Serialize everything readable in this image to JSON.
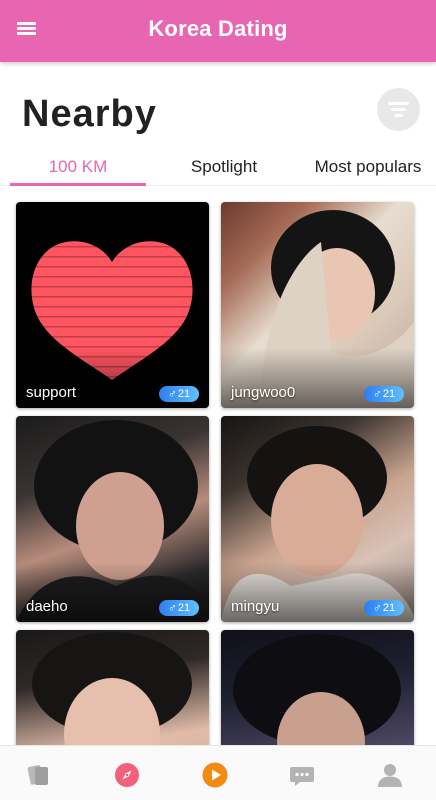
{
  "app_title": "Korea Dating",
  "page_title": "Nearby",
  "tabs": [
    {
      "label": "100 KM",
      "active": true
    },
    {
      "label": "Spotlight",
      "active": false
    },
    {
      "label": "Most populars",
      "active": false
    }
  ],
  "profiles": [
    {
      "name": "support",
      "gender_symbol": "♂",
      "age": "21",
      "photo": "pixel-heart"
    },
    {
      "name": "jungwoo0",
      "gender_symbol": "♂",
      "age": "21",
      "photo": "portrait"
    },
    {
      "name": "daeho",
      "gender_symbol": "♂",
      "age": "21",
      "photo": "portrait"
    },
    {
      "name": "mingyu",
      "gender_symbol": "♂",
      "age": "21",
      "photo": "portrait"
    },
    {
      "name": "",
      "gender_symbol": "",
      "age": "",
      "photo": "portrait"
    },
    {
      "name": "",
      "gender_symbol": "",
      "age": "",
      "photo": "portrait"
    }
  ],
  "bottom_nav": [
    {
      "icon": "cards-icon"
    },
    {
      "icon": "compass-icon"
    },
    {
      "icon": "play-icon"
    },
    {
      "icon": "chat-icon"
    },
    {
      "icon": "profile-icon"
    }
  ],
  "colors": {
    "primary": "#e865b2",
    "badge_start": "#2f7df0",
    "badge_end": "#5ec0ff",
    "heart": "#ff5560",
    "play": "#f38a12"
  }
}
